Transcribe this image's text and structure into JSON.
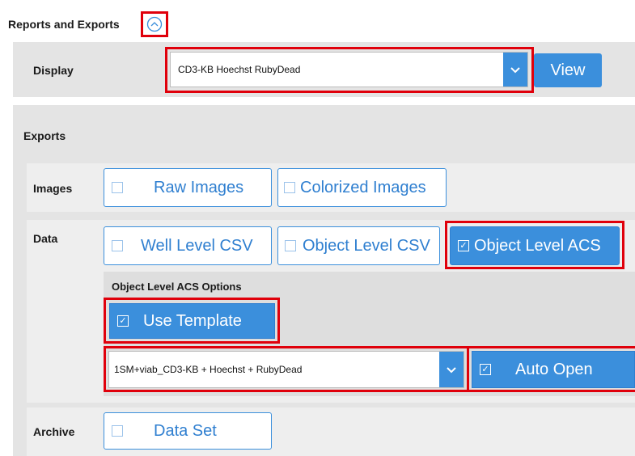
{
  "header": {
    "title": "Reports and Exports",
    "toggle_icon": "chevron-up-circle-icon"
  },
  "display": {
    "label": "Display",
    "selected": "CD3-KB Hoechst RubyDead",
    "view_button": "View"
  },
  "exports": {
    "title": "Exports",
    "images": {
      "label": "Images",
      "raw": "Raw Images",
      "colorized": "Colorized Images"
    },
    "data": {
      "label": "Data",
      "well_csv": "Well Level CSV",
      "object_csv": "Object Level CSV",
      "object_acs": "Object Level ACS",
      "options_title": "Object Level ACS Options",
      "use_template": "Use Template",
      "template_selected": "1SM+viab_CD3-KB + Hoechst + RubyDead",
      "auto_open": "Auto Open"
    },
    "archive": {
      "label": "Archive",
      "data_set": "Data Set"
    }
  },
  "colors": {
    "accent": "#3b8fdc",
    "highlight": "#e0000b",
    "panel": "#e4e4e4"
  }
}
